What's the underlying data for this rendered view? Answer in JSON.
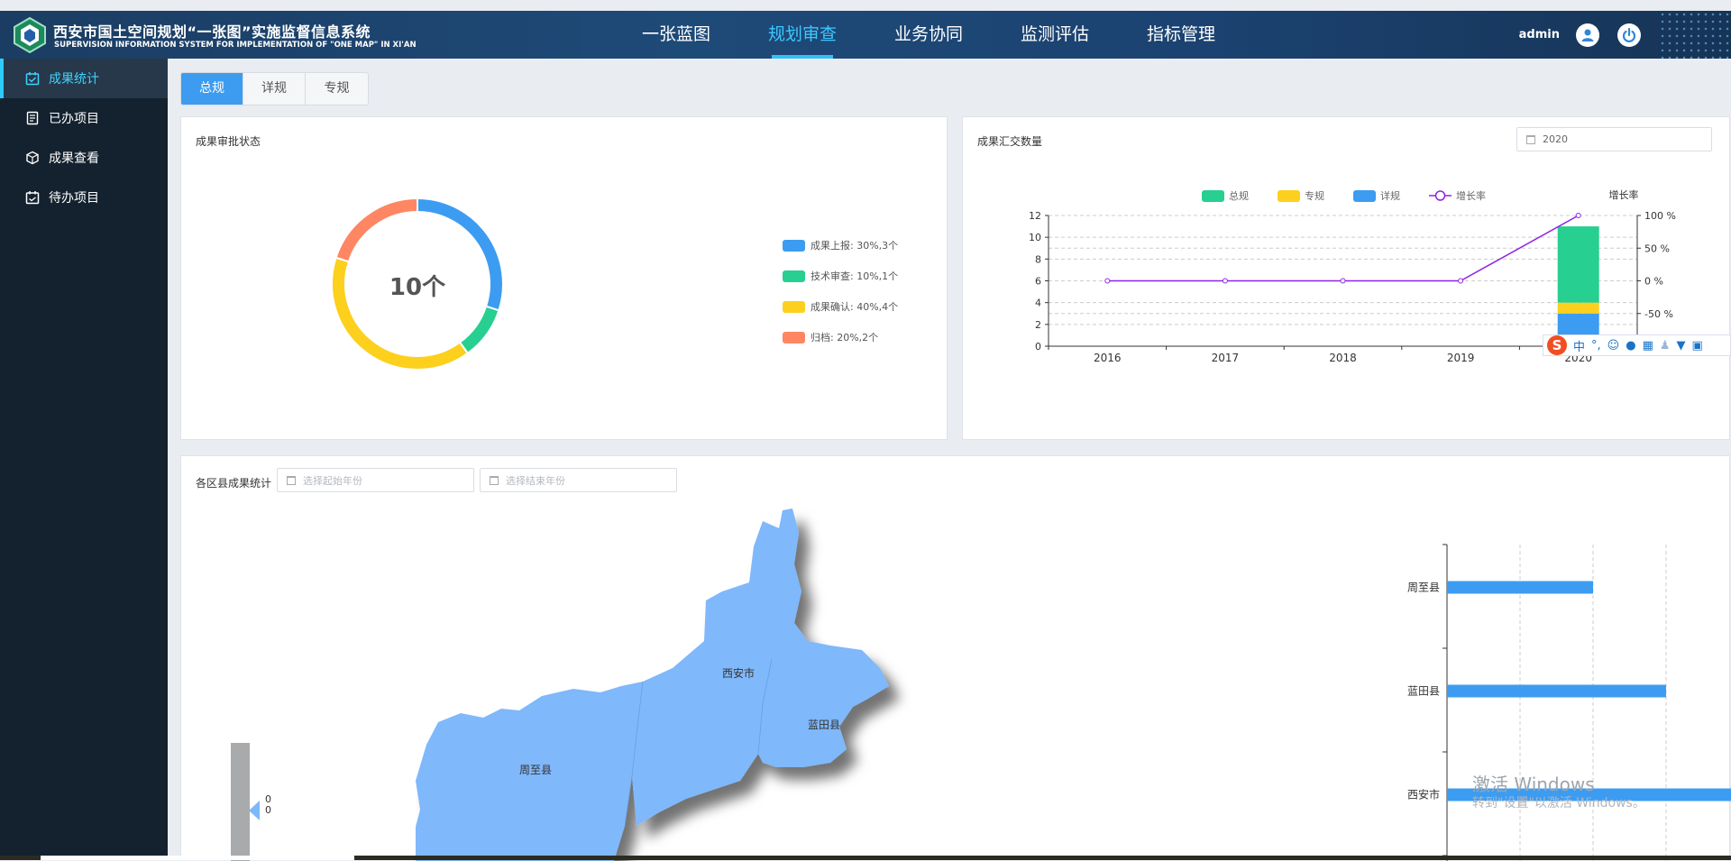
{
  "header": {
    "title_cn": "西安市国土空间规划“一张图”实施监督信息系统",
    "title_en": "SUPERVISION INFORMATION SYSTEM FOR IMPLEMENTATION OF \"ONE MAP\" IN XI'AN",
    "nav": [
      "一张蓝图",
      "规划审查",
      "业务协同",
      "监测评估",
      "指标管理"
    ],
    "active_nav": 1,
    "user": "admin",
    "icons": [
      "user-icon",
      "power-icon"
    ]
  },
  "sidebar": {
    "items": [
      {
        "label": "成果统计",
        "icon": "check-calendar-icon"
      },
      {
        "label": "已办项目",
        "icon": "document-icon"
      },
      {
        "label": "成果查看",
        "icon": "cube-icon"
      },
      {
        "label": "待办项目",
        "icon": "calendar-icon"
      }
    ],
    "active": 0
  },
  "tabs": {
    "items": [
      "总规",
      "详规",
      "专规"
    ],
    "active": 0
  },
  "approval_panel": {
    "title": "成果审批状态",
    "center_label": "10个",
    "legend": [
      {
        "label": "成果上报: 30%,3个",
        "color": "#3c9cf2"
      },
      {
        "label": "技术审查: 10%,1个",
        "color": "#27cf91"
      },
      {
        "label": "成果确认: 40%,4个",
        "color": "#fcd01c"
      },
      {
        "label": "归档: 20%,2个",
        "color": "#fe8663"
      }
    ]
  },
  "submission_panel": {
    "title": "成果汇交数量",
    "year_value": "2020",
    "right_axis_title": "增长率"
  },
  "district_panel": {
    "title": "各区县成果统计",
    "start_placeholder": "选择起始年份",
    "end_placeholder": "选择结束年份",
    "map_labels": [
      "西安市",
      "蓝田县",
      "周至县"
    ],
    "visual_map_values": [
      "0",
      "0"
    ]
  },
  "ime_bar": {
    "label": "中",
    "extra": "°,"
  },
  "watermark": {
    "line1": "激活 Windows",
    "line2": "转到\"设置\"以激活 Windows。"
  },
  "chart_data": [
    {
      "type": "pie",
      "variant": "donut",
      "categories": [
        "成果上报",
        "技术审查",
        "成果确认",
        "归档"
      ],
      "values": [
        3,
        1,
        4,
        2
      ],
      "percent": [
        30,
        10,
        40,
        20
      ],
      "colors": [
        "#3c9cf2",
        "#27cf91",
        "#fcd01c",
        "#fe8663"
      ],
      "center_text": "10个"
    },
    {
      "type": "bar",
      "stacked": true,
      "categories": [
        "2016",
        "2017",
        "2018",
        "2019",
        "2020"
      ],
      "series": [
        {
          "name": "总规",
          "type": "bar",
          "color": "#27cf91",
          "values": [
            0,
            0,
            0,
            0,
            7
          ]
        },
        {
          "name": "专规",
          "type": "bar",
          "color": "#fcd01c",
          "values": [
            0,
            0,
            0,
            0,
            1
          ]
        },
        {
          "name": "详规",
          "type": "bar",
          "color": "#3c9cf2",
          "values": [
            0,
            0,
            0,
            0,
            3
          ]
        },
        {
          "name": "增长率",
          "type": "line",
          "color": "#8f22e6",
          "axis": "right",
          "values": [
            0,
            0,
            0,
            0,
            100
          ]
        }
      ],
      "ylim": [
        0,
        12
      ],
      "yticks": [
        0,
        2,
        4,
        6,
        8,
        10,
        12
      ],
      "y2lim": [
        -100,
        100
      ],
      "y2ticks": [
        "100 %",
        "50 %",
        "0 %",
        "-50 %",
        "-100 %"
      ],
      "y2label": "增长率",
      "grid": true,
      "legend_position": "top"
    },
    {
      "type": "bar",
      "orientation": "horizontal",
      "categories": [
        "周至县",
        "蓝田县",
        "西安市"
      ],
      "values": [
        2,
        3,
        5
      ],
      "color": "#3c9cf2",
      "grid": true
    }
  ]
}
